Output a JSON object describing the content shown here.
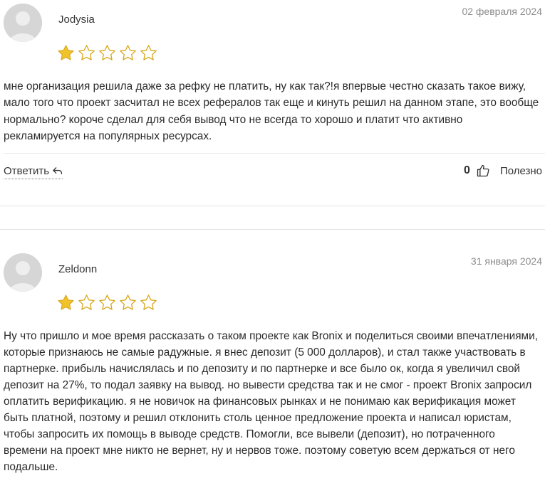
{
  "colors": {
    "star_filled": "#f0c32a",
    "star_empty_outline": "#d9a81e",
    "date_text": "#8c8c8c",
    "avatar_bg": "#d6d6d6"
  },
  "reviews": [
    {
      "author": "Jodysia",
      "date": "02 февраля 2024",
      "rating": 1,
      "rating_max": 5,
      "text": "мне организация решила даже за рефку не платить, ну как так?!я впервые честно сказать такое вижу, мало того что проект засчитал не всех рефералов так еще и кинуть решил на данном этапе, это вообще нормально? короче сделал для себя вывод что не всегда то хорошо и платит что активно рекламируется на популярных ресурсах.",
      "reply_label": "Ответить",
      "likes": "0",
      "helpful_label": "Полезно"
    },
    {
      "author": "Zeldonn",
      "date": "31 января 2024",
      "rating": 1,
      "rating_max": 5,
      "text": "Ну что пришло и мое время рассказать о таком проекте как Bronix и поделиться своими впечатлениями, которые признаюсь не самые радужные. я внес депозит (5 000 долларов), и стал также участвовать в партнерке. прибыль начислялась и по депозиту и по партнерке и все было ок, когда я увеличил свой депозит на 27%, то подал заявку на вывод. но вывести средства так и не смог - проект Bronix запросил оплатить верификацию. я не новичок на финансовых рынках и не понимаю как верификация может быть платной, поэтому и решил отклонить столь ценное предложение проекта и написал юристам, чтобы запросить их помощь в выводе средств. Помогли, все вывели (депозит), но потраченного времени на проект мне никто не вернет, ну и нервов тоже. поэтому советую всем держаться от него подальше."
    }
  ]
}
